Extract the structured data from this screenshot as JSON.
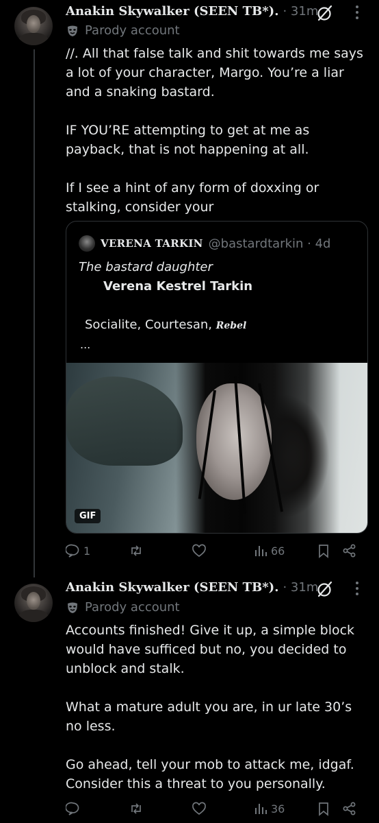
{
  "tweets": [
    {
      "author_name": "Anakin Skywalker (SEEN TB*).",
      "time": "· 31m",
      "badge_label": "Parody account",
      "body": "//. All that false talk and shit towards me says a lot of your character, Margo. You’re a liar and a snaking bastard.\n\nIF YOU’RE attempting to get at me as payback, that is not happening at all.\n\nIf I see a hint of any form of doxxing or stalking, consider your",
      "quote": {
        "name": "VERENA TARKIN",
        "handle": "@bastardtarkin · 4d",
        "line1": "The bastard daughter",
        "line2": "Verena Kestrel Tarkin",
        "line3": "Socialite, Courtesan, ",
        "line3_rebel": "Rebel",
        "line4": "...",
        "media_badge": "GIF"
      },
      "actions": {
        "reply_count": "1",
        "repost_count": "",
        "like_count": "",
        "views_count": "66"
      }
    },
    {
      "author_name": "Anakin Skywalker (SEEN TB*).",
      "time": "· 31m",
      "badge_label": "Parody account",
      "body": "Accounts finished! Give it up, a simple block would have sufficed but no, you decided to unblock and stalk.\n\nWhat a mature adult you are, in ur late 30’s no less.\n\nGo ahead, tell your mob to attack me, idgaf. Consider this a threat to you personally.",
      "actions": {
        "reply_count": "",
        "repost_count": "",
        "like_count": "",
        "views_count": "36"
      }
    }
  ],
  "icons": {
    "no_view": "slashed-circle-icon",
    "more": "more-vertical-icon",
    "parody": "mask-icon",
    "reply": "reply-icon",
    "repost": "repost-icon",
    "like": "heart-icon",
    "views": "views-bars-icon",
    "bookmark": "bookmark-icon",
    "share": "share-icon"
  },
  "colors": {
    "background": "#000000",
    "text": "#e7e9ea",
    "muted": "#71767b",
    "border": "#2f3336"
  }
}
